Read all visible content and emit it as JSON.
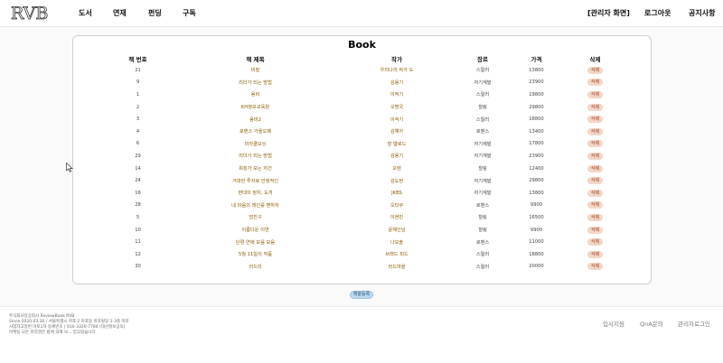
{
  "nav": {
    "logo": "RVB",
    "left_items": [
      "도서",
      "연재",
      "펀딩",
      "구독"
    ],
    "right_items": [
      "[관리자 화면]",
      "로그아웃",
      "공지사항"
    ]
  },
  "card": {
    "title": "Book",
    "columns": [
      "책 번호",
      "책 제목",
      "작가",
      "장르",
      "가격",
      "삭제"
    ],
    "rows": [
      {
        "no": "21",
        "title": "비밀",
        "author": "우리나라 작가 도",
        "genre": "스릴러",
        "price": "13800"
      },
      {
        "no": "9",
        "title": "리더가 되는 방법",
        "author": "김용기",
        "genre": "자기계발",
        "price": "23900"
      },
      {
        "no": "1",
        "title": "용비",
        "author": "이적기",
        "genre": "스릴러",
        "price": "19800"
      },
      {
        "no": "2",
        "title": "KH정보교육원",
        "author": "오명국",
        "genre": "힐링",
        "price": "29800"
      },
      {
        "no": "3",
        "title": "용비2",
        "author": "이적기",
        "genre": "스릴러",
        "price": "18800"
      },
      {
        "no": "4",
        "title": "로맨스 가을오페",
        "author": "김예아",
        "genre": "로맨스",
        "price": "13400"
      },
      {
        "no": "6",
        "title": "미라클모닝",
        "author": "할 엘로드",
        "genre": "자기계발",
        "price": "17800"
      },
      {
        "no": "29",
        "title": "리더가 되는 방법",
        "author": "김용기",
        "genre": "자기계발",
        "price": "23900"
      },
      {
        "no": "14",
        "title": "워킹가 모는 저건",
        "author": "오렌",
        "genre": "힐링",
        "price": "12400"
      },
      {
        "no": "24",
        "title": "거대한 투자로 안정적인",
        "author": "김도현",
        "genre": "자기계발",
        "price": "29800"
      },
      {
        "no": "16",
        "title": "현대의 정치, 도끼",
        "author": "JKBS",
        "genre": "자기계발",
        "price": "13800"
      },
      {
        "no": "28",
        "title": "내 마음의 레인를 밴하자",
        "author": "오타쿠",
        "genre": "로맨스",
        "price": "9900"
      },
      {
        "no": "5",
        "title": "엄친구",
        "author": "이현빈",
        "genre": "힐링",
        "price": "16500"
      },
      {
        "no": "10",
        "title": "이름다운 이연",
        "author": "윤해인님",
        "genre": "힐링",
        "price": "9900"
      },
      {
        "no": "11",
        "title": "단편 연애 모음 모음",
        "author": "나모솔",
        "genre": "로맨스",
        "price": "11000"
      },
      {
        "no": "12",
        "title": "5월 11일의 작품",
        "author": "브래드 피드",
        "genre": "스릴러",
        "price": "18800"
      },
      {
        "no": "30",
        "title": "러드미",
        "author": "러드마을",
        "genre": "스릴러",
        "price": "20000"
      }
    ],
    "delete_label": "삭제"
  },
  "write_button": "책을등록",
  "footer": {
    "info": [
      "주식회사일상회사 ReviewBook RVB",
      "Since 2020.03.30 / 서울특별시 마포구 마포동 마포빌딩 1-3층 마포",
      "사업자고일번 마포1자 등록번호 | 010-3320-7784 (대산정보공익)",
      "마케팅 모든 저작권은 법에 의해 보... 받고있습니다"
    ],
    "links": [
      "입사지원",
      "QnA문의",
      "관리자로그인"
    ]
  }
}
